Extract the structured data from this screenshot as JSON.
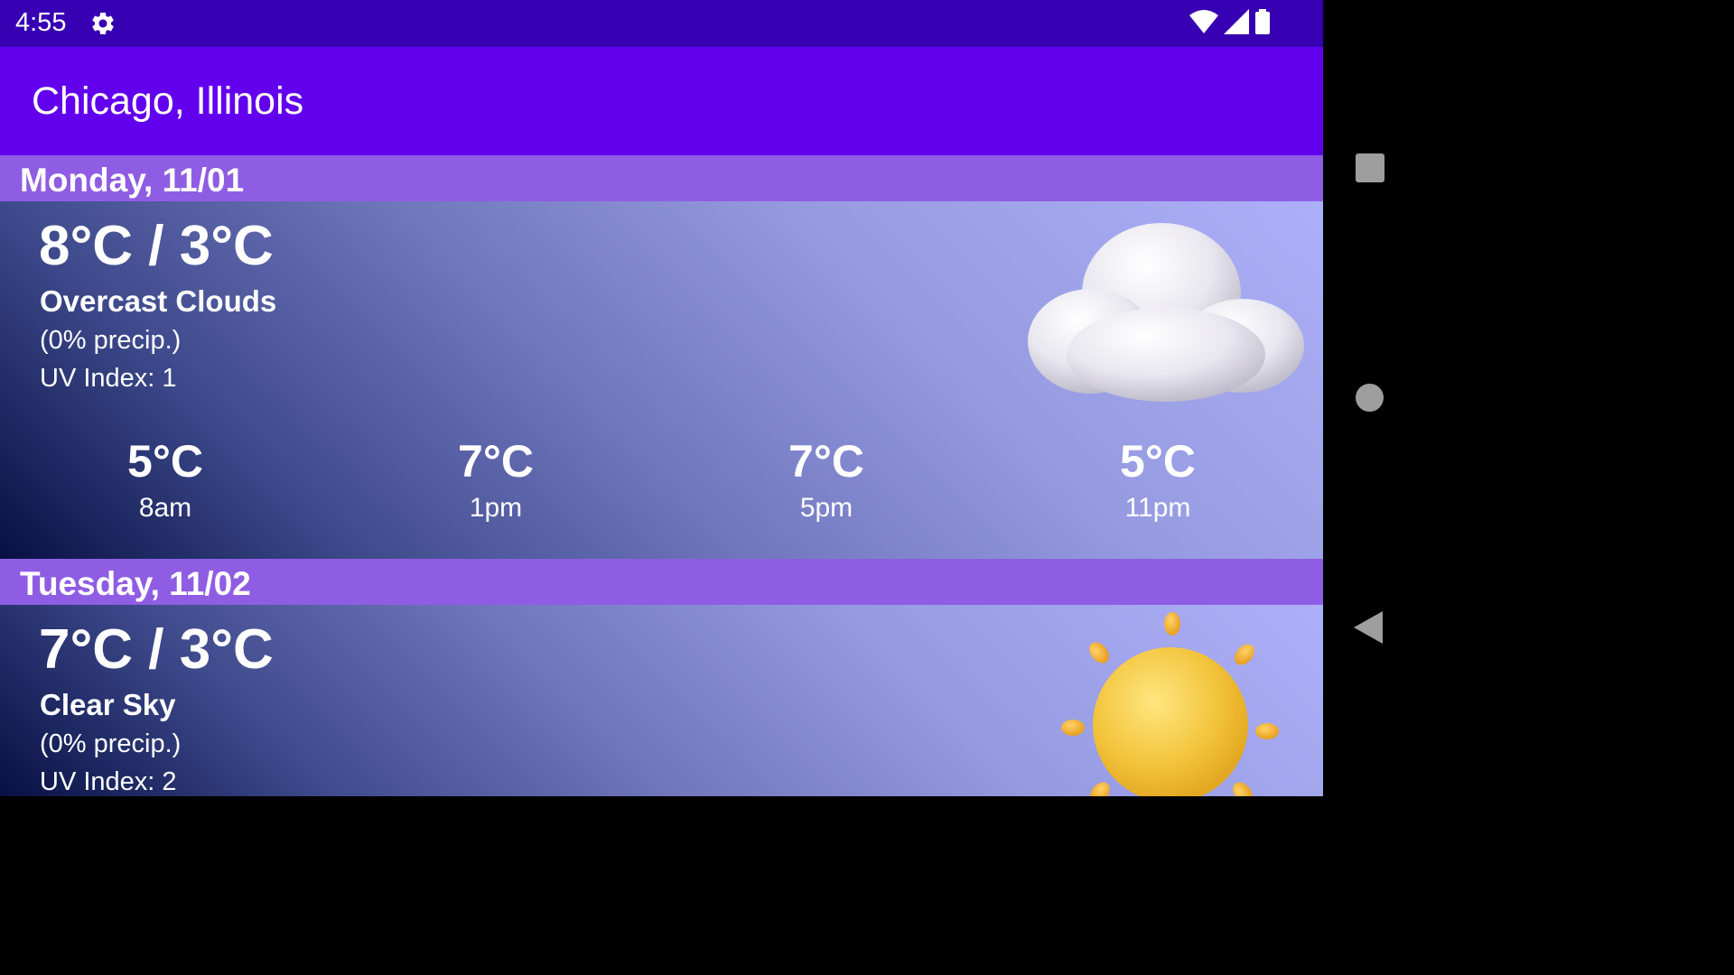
{
  "status_bar": {
    "time": "4:55",
    "icons": [
      "gear-icon",
      "wifi-icon",
      "signal-icon",
      "battery-icon"
    ]
  },
  "app_bar": {
    "title": "Chicago, Illinois"
  },
  "days": [
    {
      "date": "Monday, 11/01",
      "temp_range": "8°C / 3°C",
      "condition": "Overcast Clouds",
      "precip": "(0% precip.)",
      "uv": "UV Index: 1",
      "icon": "cloud-icon",
      "hourly": [
        {
          "temp": "5°C",
          "time": "8am"
        },
        {
          "temp": "7°C",
          "time": "1pm"
        },
        {
          "temp": "7°C",
          "time": "5pm"
        },
        {
          "temp": "5°C",
          "time": "11pm"
        }
      ]
    },
    {
      "date": "Tuesday, 11/02",
      "temp_range": "7°C / 3°C",
      "condition": "Clear Sky",
      "precip": "(0% precip.)",
      "uv": "UV Index: 2",
      "icon": "sun-icon"
    }
  ],
  "nav_bar": {
    "buttons": [
      "recents-button",
      "home-button",
      "back-button"
    ]
  },
  "colors": {
    "status_bar": "#3700b3",
    "app_bar": "#6200ee",
    "day_header": "#8f5de3"
  }
}
